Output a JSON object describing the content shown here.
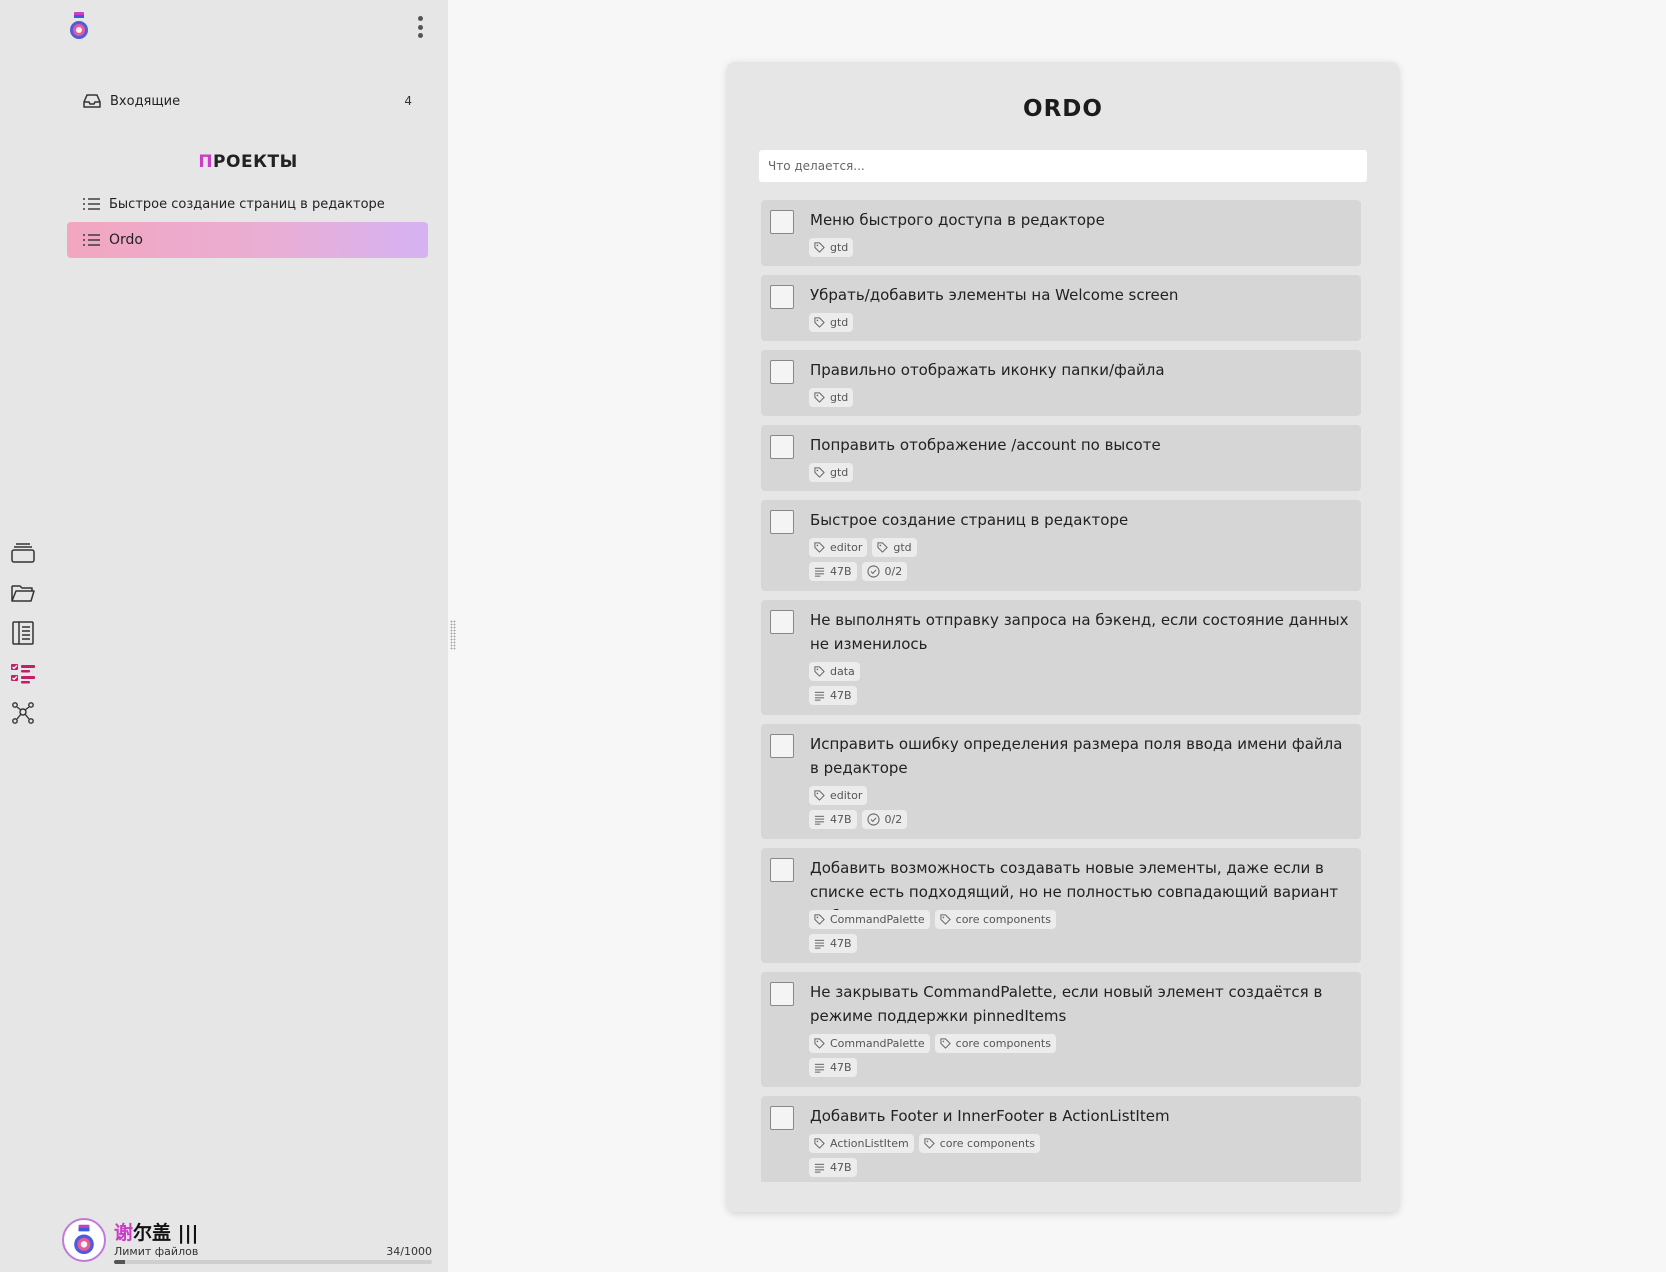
{
  "sidebar": {
    "inbox": {
      "label": "Входящие",
      "count": "4"
    },
    "projects_title_first": "П",
    "projects_title_rest": "РОЕКТЫ",
    "projects": [
      {
        "label": "Быстрое создание страниц в редакторе",
        "active": false
      },
      {
        "label": "Ordo",
        "active": true
      }
    ],
    "rail_icons": [
      "stack-icon",
      "folder-icon",
      "notebook-icon",
      "checklist-icon",
      "graph-icon"
    ],
    "user": {
      "name_accent": "谢",
      "name_rest": "尔盖 |||",
      "limit_label": "Лимит файлов",
      "limit_count": "34/1000",
      "limit_fraction": 0.034
    }
  },
  "main": {
    "title": "ORDO",
    "search_placeholder": "Что делается...",
    "tasks": [
      {
        "title": "Меню быстрого доступа в редакторе",
        "tags": [
          "gtd"
        ]
      },
      {
        "title": "Убрать/добавить элементы на Welcome screen",
        "tags": [
          "gtd"
        ]
      },
      {
        "title": "Правильно отображать иконку папки/файла",
        "tags": [
          "gtd"
        ]
      },
      {
        "title": "Поправить отображение /account по высоте",
        "tags": [
          "gtd"
        ]
      },
      {
        "title": "Быстрое создание страниц в редакторе",
        "tags": [
          "editor",
          "gtd"
        ],
        "size": "47B",
        "progress": "0/2"
      },
      {
        "title": "Не выполнять отправку запроса на бэкенд, если состояние данных не изменилось",
        "tags": [
          "data"
        ],
        "size": "47B"
      },
      {
        "title": "Исправить ошибку определения размера поля ввода имени файла в редакторе",
        "tags": [
          "editor"
        ],
        "size": "47B",
        "progress": "0/2"
      },
      {
        "title": "Добавить возможность создавать новые элементы, даже если в списке есть подходящий, но не полностью совпадающий вариант выбора",
        "tags": [
          "CommandPalette",
          "core components"
        ],
        "size": "47B"
      },
      {
        "title": "Не закрывать CommandPalette, если новый элемент создаётся в режиме поддержки pinnedItems",
        "tags": [
          "CommandPalette",
          "core components"
        ],
        "size": "47B"
      },
      {
        "title": "Добавить Footer и InnerFooter в ActionListItem",
        "tags": [
          "ActionListItem",
          "core components"
        ],
        "size": "47B"
      }
    ]
  },
  "colors": {
    "accent": "#c93dc7",
    "active_gradient_start": "#f2a6bf",
    "active_gradient_end": "#d5b2f3",
    "rail_active": "#c21f6a"
  }
}
